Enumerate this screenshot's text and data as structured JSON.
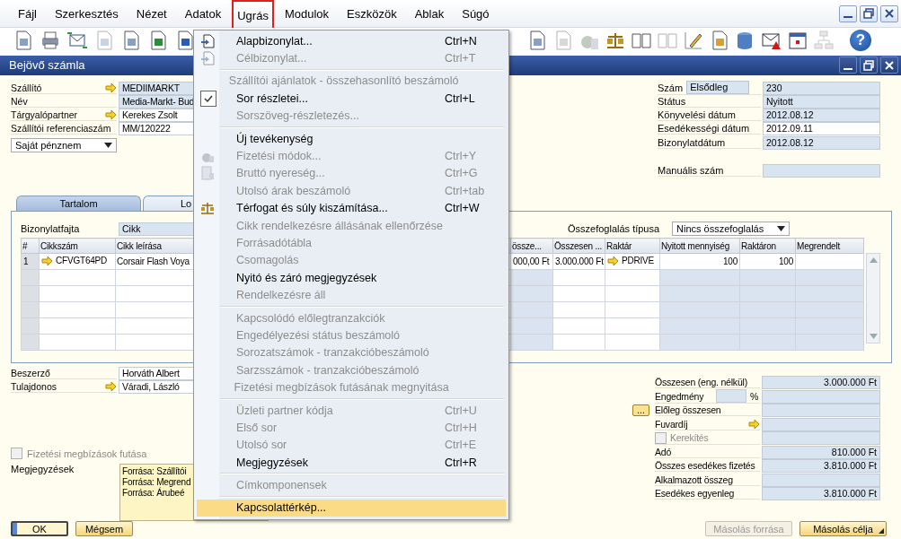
{
  "menubar": [
    {
      "label": "Fájl",
      "selected": false
    },
    {
      "label": "Szerkesztés",
      "selected": false
    },
    {
      "label": "Nézet",
      "selected": false
    },
    {
      "label": "Adatok",
      "selected": false
    },
    {
      "label": "Ugrás",
      "selected": true
    },
    {
      "label": "Modulok",
      "selected": false
    },
    {
      "label": "Eszközök",
      "selected": false
    },
    {
      "label": "Ablak",
      "selected": false
    },
    {
      "label": "Súgó",
      "selected": false
    }
  ],
  "toolbar": {
    "help_glyph": "?"
  },
  "window": {
    "title": "Bejövő számla"
  },
  "header_left": [
    {
      "label": "Szállító",
      "value": "MEDIIMARKT",
      "link": true,
      "editable": false
    },
    {
      "label": "Név",
      "value": "Media-Markt- Bud",
      "link": false,
      "editable": false
    },
    {
      "label": "Tárgyalópartner",
      "value": "Kerekes Zsolt",
      "link": true,
      "editable": true
    },
    {
      "label": "Szállítói referenciaszám",
      "value": "MM/120222",
      "link": false,
      "editable": true
    }
  ],
  "currency": {
    "value": "Saját pénznem"
  },
  "header_right": [
    {
      "label": "Szám",
      "series": "Elsődleg",
      "value": "230",
      "editable": false
    },
    {
      "label": "Státus",
      "value": "Nyitott",
      "editable": false
    },
    {
      "label": "Könyvelési dátum",
      "value": "2012.08.12",
      "editable": false
    },
    {
      "label": "Esedékességi dátum",
      "value": "2012.09.11",
      "editable": true
    },
    {
      "label": "Bizonylatdátum",
      "value": "2012.08.12",
      "editable": false
    }
  ],
  "manual_number": {
    "label": "Manuális szám"
  },
  "tabs": [
    {
      "label": "Tartalom",
      "selected": true
    },
    {
      "label": "Lo",
      "selected": false
    }
  ],
  "doc_type": {
    "label": "Bizonylatfajta",
    "value": "Cikk"
  },
  "summary_type": {
    "label": "Összefoglalás típusa",
    "value": "Nincs összefoglalás"
  },
  "table": {
    "columns": [
      "#",
      "Cikkszám",
      "Cikk leírása",
      "össze...",
      "Összesen ...",
      "Raktár",
      "Nyitott mennyiség",
      "Raktáron",
      "Megrendelt"
    ],
    "rows": [
      {
        "cells": [
          {
            "text": "1",
            "link": false
          },
          {
            "text": "CFVGT64PD",
            "link": true
          },
          {
            "text": "Corsair Flash Voya",
            "link": false
          },
          {
            "text": "000,00 Ft",
            "link": false
          },
          {
            "text": "3.000.000 Ft",
            "link": false
          },
          {
            "text": "PDRIVE",
            "link": true
          },
          {
            "text": "100",
            "link": false
          },
          {
            "text": "100",
            "link": false
          }
        ]
      }
    ]
  },
  "bottom_left": [
    {
      "label": "Beszerző",
      "value": "Horváth Albert",
      "link": false
    },
    {
      "label": "Tulajdonos",
      "value": "Váradi, László",
      "link": true
    }
  ],
  "payment_run": {
    "label": "Fizetési megbízások futása",
    "checked": false,
    "disabled": true
  },
  "remarks": {
    "label": "Megjegyzések",
    "lines": [
      "Forrása: Szállítói",
      "Forrása: Megrend",
      "Forrása: Árubeé"
    ]
  },
  "totals": [
    {
      "kind": "field",
      "label": "Összesen (eng. nélkül)",
      "value": "3.000.000 Ft"
    },
    {
      "kind": "discount",
      "label": "Engedmény",
      "unit": "%"
    },
    {
      "kind": "button",
      "label": "Előleg összesen",
      "button": "..."
    },
    {
      "kind": "link",
      "label": "Fuvardíj"
    },
    {
      "kind": "checkbox",
      "label": "Kerekítés",
      "checked": false,
      "disabled": true
    },
    {
      "kind": "field",
      "label": "Adó",
      "value": "810.000 Ft"
    },
    {
      "kind": "field",
      "label": "Összes esedékes fizetés",
      "value": "3.810.000 Ft"
    },
    {
      "kind": "field",
      "label": "Alkalmazott összeg"
    },
    {
      "kind": "field",
      "label": "Esedékes egyenleg",
      "value": "3.810.000 Ft"
    }
  ],
  "buttons_left": [
    {
      "label": "OK",
      "default": true
    },
    {
      "label": "Mégsem",
      "default": false
    }
  ],
  "buttons_right": [
    {
      "label": "Másolás forrása",
      "disabled": true,
      "dropdown": false
    },
    {
      "label": "Másolás célja",
      "disabled": false,
      "dropdown": true
    }
  ],
  "menu": {
    "items": [
      {
        "kind": "item",
        "label": "Alapbizonylat...",
        "shortcut": "Ctrl+N",
        "disabled": false,
        "checked": false,
        "selected": false
      },
      {
        "kind": "item",
        "label": "Célbizonylat...",
        "shortcut": "Ctrl+T",
        "disabled": true,
        "checked": false,
        "selected": false
      },
      {
        "kind": "separator"
      },
      {
        "kind": "item",
        "label": "Szállítói ajánlatok - összehasonlító beszámoló",
        "disabled": true,
        "checked": false,
        "selected": false
      },
      {
        "kind": "item",
        "label": "Sor részletei...",
        "shortcut": "Ctrl+L",
        "disabled": false,
        "checked": true,
        "selected": false
      },
      {
        "kind": "item",
        "label": "Sorszöveg-részletezés...",
        "disabled": true,
        "checked": false,
        "selected": false
      },
      {
        "kind": "separator"
      },
      {
        "kind": "item",
        "label": "Új tevékenység",
        "disabled": false,
        "checked": false,
        "selected": false
      },
      {
        "kind": "item",
        "label": "Fizetési módok...",
        "shortcut": "Ctrl+Y",
        "disabled": true,
        "checked": false,
        "selected": false
      },
      {
        "kind": "item",
        "label": "Bruttó nyereség...",
        "shortcut": "Ctrl+G",
        "disabled": true,
        "checked": false,
        "selected": false
      },
      {
        "kind": "item",
        "label": "Utolsó árak beszámoló",
        "shortcut": "Ctrl+tab",
        "disabled": true,
        "checked": false,
        "selected": false
      },
      {
        "kind": "item",
        "label": "Térfogat és súly kiszámítása...",
        "shortcut": "Ctrl+W",
        "disabled": false,
        "checked": false,
        "selected": false
      },
      {
        "kind": "item",
        "label": "Cikk rendelkezésre állásának ellenőrzése",
        "disabled": true,
        "checked": false,
        "selected": false
      },
      {
        "kind": "item",
        "label": "Forrásadótábla",
        "disabled": true,
        "checked": false,
        "selected": false
      },
      {
        "kind": "item",
        "label": "Csomagolás",
        "disabled": true,
        "checked": false,
        "selected": false
      },
      {
        "kind": "item",
        "label": "Nyitó és záró megjegyzések",
        "disabled": false,
        "checked": false,
        "selected": false
      },
      {
        "kind": "item",
        "label": "Rendelkezésre áll",
        "disabled": true,
        "checked": false,
        "selected": false
      },
      {
        "kind": "separator"
      },
      {
        "kind": "item",
        "label": "Kapcsolódó előlegtranzakciók",
        "disabled": true,
        "checked": false,
        "selected": false
      },
      {
        "kind": "item",
        "label": "Engedélyezési státus beszámoló",
        "disabled": true,
        "checked": false,
        "selected": false
      },
      {
        "kind": "item",
        "label": "Sorozatszámok - tranzakcióbeszámoló",
        "disabled": true,
        "checked": false,
        "selected": false
      },
      {
        "kind": "item",
        "label": "Sarzsszámok - tranzakcióbeszámoló",
        "disabled": true,
        "checked": false,
        "selected": false
      },
      {
        "kind": "item",
        "label": "Fizetési megbízások futásának megnyitása",
        "disabled": true,
        "checked": false,
        "selected": false
      },
      {
        "kind": "separator"
      },
      {
        "kind": "item",
        "label": "Üzleti partner kódja",
        "shortcut": "Ctrl+U",
        "disabled": true,
        "checked": false,
        "selected": false
      },
      {
        "kind": "item",
        "label": "Első sor",
        "shortcut": "Ctrl+H",
        "disabled": true,
        "checked": false,
        "selected": false
      },
      {
        "kind": "item",
        "label": "Utolsó sor",
        "shortcut": "Ctrl+E",
        "disabled": true,
        "checked": false,
        "selected": false
      },
      {
        "kind": "item",
        "label": "Megjegyzések",
        "shortcut": "Ctrl+R",
        "disabled": false,
        "checked": false,
        "selected": false
      },
      {
        "kind": "separator"
      },
      {
        "kind": "item",
        "label": "Címkomponensek",
        "disabled": true,
        "checked": false,
        "selected": false
      },
      {
        "kind": "separator"
      },
      {
        "kind": "item",
        "label": "Kapcsolattérkép...",
        "disabled": false,
        "checked": false,
        "selected": true
      }
    ]
  }
}
